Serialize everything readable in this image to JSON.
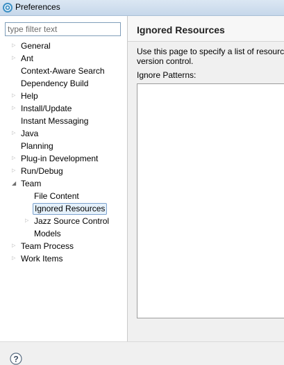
{
  "window": {
    "title": "Preferences",
    "icon": "eclipse-preferences-icon"
  },
  "filter": {
    "placeholder": "type filter text",
    "value": ""
  },
  "tree": [
    {
      "label": "General",
      "expandable": true,
      "expanded": false,
      "selected": false
    },
    {
      "label": "Ant",
      "expandable": true,
      "expanded": false,
      "selected": false
    },
    {
      "label": "Context-Aware Search",
      "expandable": false,
      "expanded": false,
      "selected": false
    },
    {
      "label": "Dependency Build",
      "expandable": false,
      "expanded": false,
      "selected": false
    },
    {
      "label": "Help",
      "expandable": true,
      "expanded": false,
      "selected": false
    },
    {
      "label": "Install/Update",
      "expandable": true,
      "expanded": false,
      "selected": false
    },
    {
      "label": "Instant Messaging",
      "expandable": false,
      "expanded": false,
      "selected": false
    },
    {
      "label": "Java",
      "expandable": true,
      "expanded": false,
      "selected": false
    },
    {
      "label": "Planning",
      "expandable": false,
      "expanded": false,
      "selected": false
    },
    {
      "label": "Plug-in Development",
      "expandable": true,
      "expanded": false,
      "selected": false
    },
    {
      "label": "Run/Debug",
      "expandable": true,
      "expanded": false,
      "selected": false
    },
    {
      "label": "Team",
      "expandable": true,
      "expanded": true,
      "selected": false
    },
    {
      "label": "File Content",
      "expandable": false,
      "expanded": false,
      "selected": false,
      "child": true
    },
    {
      "label": "Ignored Resources",
      "expandable": false,
      "expanded": false,
      "selected": true,
      "child": true
    },
    {
      "label": "Jazz Source Control",
      "expandable": true,
      "expanded": false,
      "selected": false,
      "child": true
    },
    {
      "label": "Models",
      "expandable": false,
      "expanded": false,
      "selected": false,
      "child": true
    },
    {
      "label": "Team Process",
      "expandable": true,
      "expanded": false,
      "selected": false
    },
    {
      "label": "Work Items",
      "expandable": true,
      "expanded": false,
      "selected": false
    }
  ],
  "page": {
    "title": "Ignored Resources",
    "description_line1": "Use this page to specify a list of resource",
    "description_line2": "version control.",
    "patterns_label": "Ignore Patterns:"
  },
  "footer": {
    "help_icon": "help-icon"
  },
  "colors": {
    "selection_bg": "#e5f1fb",
    "selection_border": "#7da2ce"
  }
}
